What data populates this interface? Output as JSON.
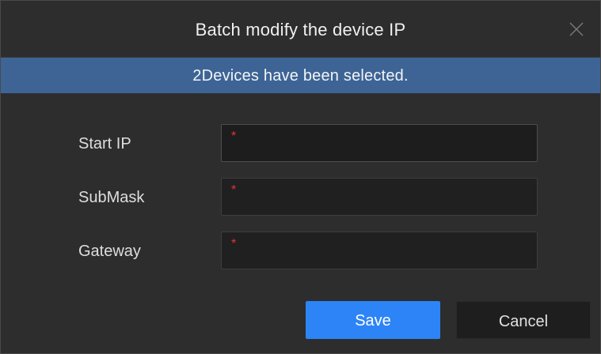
{
  "dialog": {
    "title": "Batch modify the device IP",
    "close_icon": "close-icon",
    "banner": "2Devices have been selected."
  },
  "form": {
    "fields": [
      {
        "label": "Start IP",
        "value": "",
        "required_mark": "*"
      },
      {
        "label": "SubMask",
        "value": "",
        "required_mark": "*"
      },
      {
        "label": "Gateway",
        "value": "",
        "required_mark": "*"
      }
    ]
  },
  "buttons": {
    "save": "Save",
    "cancel": "Cancel"
  },
  "colors": {
    "background": "#2d2d2d",
    "banner": "#3d6495",
    "primary": "#2d84f6",
    "required": "#e23434"
  }
}
